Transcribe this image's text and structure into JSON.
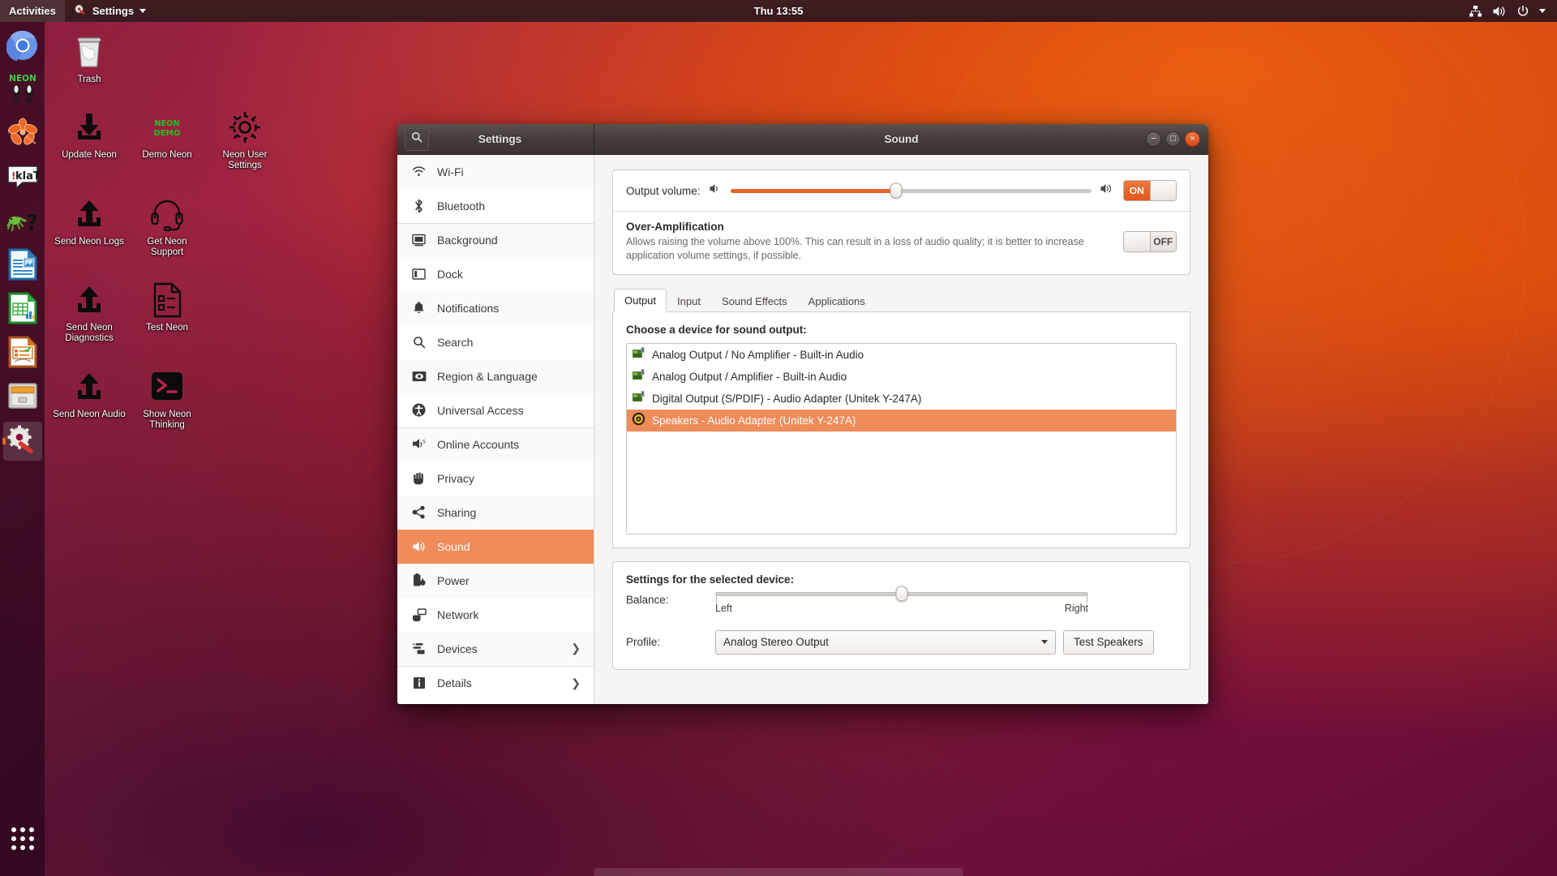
{
  "top_panel": {
    "activities": "Activities",
    "app_menu": "Settings",
    "app_menu_icon": "settings-gear-wrench-icon",
    "clock": "Thu 13:55",
    "tray_icons": [
      "network-wired-icon",
      "volume-icon",
      "power-icon",
      "caret-down-icon"
    ]
  },
  "dock": {
    "items": [
      {
        "name": "chromium",
        "icon": "chromium-icon",
        "active": false
      },
      {
        "name": "neon-mics",
        "icon": "neon-microphones-icon",
        "active": false
      },
      {
        "name": "mycroft-flower",
        "icon": "mycroft-flower-icon",
        "active": false
      },
      {
        "name": "klat",
        "icon": "klat-speech-bubble-icon",
        "active": false
      },
      {
        "name": "gecko-help",
        "icon": "gecko-question-icon",
        "active": false
      },
      {
        "name": "libreoffice-writer",
        "icon": "libreoffice-writer-icon",
        "active": false
      },
      {
        "name": "libreoffice-calc",
        "icon": "libreoffice-calc-icon",
        "active": false
      },
      {
        "name": "libreoffice-impress",
        "icon": "libreoffice-impress-icon",
        "active": false
      },
      {
        "name": "file-manager",
        "icon": "file-cabinet-icon",
        "active": false
      },
      {
        "name": "settings",
        "icon": "settings-gear-wrench-icon",
        "active": true
      }
    ],
    "show_apps": "show-applications-icon"
  },
  "desktop_icons": [
    {
      "label": "Trash",
      "icon": "trash-icon"
    },
    {
      "label": "Update Neon",
      "icon": "download-arrow-icon"
    },
    {
      "label": "Demo Neon",
      "icon": "neon-demo-text-icon",
      "badge": "NEON\nDEMO"
    },
    {
      "label": "Neon User Settings",
      "icon": "gear-icon"
    },
    {
      "label": "Send Neon Logs",
      "icon": "upload-arrow-icon"
    },
    {
      "label": "Get Neon Support",
      "icon": "headset-icon"
    },
    {
      "label": "Send Neon Diagnostics",
      "icon": "upload-arrow-icon"
    },
    {
      "label": "Test Neon",
      "icon": "document-checklist-icon"
    },
    {
      "label": "Send Neon Audio",
      "icon": "upload-arrow-icon"
    },
    {
      "label": "Show Neon Thinking",
      "icon": "terminal-icon"
    }
  ],
  "window": {
    "sidebar_title": "Settings",
    "title": "Sound",
    "search_icon": "search-icon",
    "controls": {
      "minimize": "−",
      "maximize": "□",
      "close": "×"
    }
  },
  "sidebar": {
    "items": [
      {
        "label": "Wi-Fi",
        "icon": "wifi-icon",
        "selected": false,
        "chevron": false,
        "group_start": false
      },
      {
        "label": "Bluetooth",
        "icon": "bluetooth-icon",
        "selected": false,
        "chevron": false,
        "group_start": false
      },
      {
        "label": "Background",
        "icon": "background-icon",
        "selected": false,
        "chevron": false,
        "group_start": true
      },
      {
        "label": "Dock",
        "icon": "dock-icon",
        "selected": false,
        "chevron": false,
        "group_start": false
      },
      {
        "label": "Notifications",
        "icon": "bell-icon",
        "selected": false,
        "chevron": false,
        "group_start": false
      },
      {
        "label": "Search",
        "icon": "search-icon",
        "selected": false,
        "chevron": false,
        "group_start": false
      },
      {
        "label": "Region & Language",
        "icon": "region-language-icon",
        "selected": false,
        "chevron": false,
        "group_start": false
      },
      {
        "label": "Universal Access",
        "icon": "universal-access-icon",
        "selected": false,
        "chevron": false,
        "group_start": false
      },
      {
        "label": "Online Accounts",
        "icon": "online-accounts-icon",
        "selected": false,
        "chevron": false,
        "group_start": true
      },
      {
        "label": "Privacy",
        "icon": "privacy-hand-icon",
        "selected": false,
        "chevron": false,
        "group_start": false
      },
      {
        "label": "Sharing",
        "icon": "sharing-icon",
        "selected": false,
        "chevron": false,
        "group_start": false
      },
      {
        "label": "Sound",
        "icon": "sound-icon",
        "selected": true,
        "chevron": false,
        "group_start": false
      },
      {
        "label": "Power",
        "icon": "power-battery-icon",
        "selected": false,
        "chevron": false,
        "group_start": false
      },
      {
        "label": "Network",
        "icon": "network-icon",
        "selected": false,
        "chevron": false,
        "group_start": false
      },
      {
        "label": "Devices",
        "icon": "devices-icon",
        "selected": false,
        "chevron": true,
        "group_start": false
      },
      {
        "label": "Details",
        "icon": "details-info-icon",
        "selected": false,
        "chevron": true,
        "group_start": true
      }
    ]
  },
  "sound": {
    "output_volume_label": "Output volume:",
    "output_volume_percent": 46,
    "volume_low_icon": "volume-low-icon",
    "volume_high_icon": "volume-high-icon",
    "output_toggle": {
      "state": "ON",
      "label": "ON"
    },
    "over_amplification": {
      "title": "Over-Amplification",
      "description": "Allows raising the volume above 100%. This can result in a loss of audio quality; it is better to increase application volume settings, if possible.",
      "toggle": {
        "state": "OFF",
        "label": "OFF"
      }
    },
    "tabs": [
      {
        "label": "Output",
        "active": true
      },
      {
        "label": "Input",
        "active": false
      },
      {
        "label": "Sound Effects",
        "active": false
      },
      {
        "label": "Applications",
        "active": false
      }
    ],
    "choose_device_label": "Choose a device for sound output:",
    "devices": [
      {
        "label": "Analog Output / No Amplifier - Built-in Audio",
        "icon": "audio-card-icon",
        "selected": false
      },
      {
        "label": "Analog Output / Amplifier - Built-in Audio",
        "icon": "audio-card-icon",
        "selected": false
      },
      {
        "label": "Digital Output (S/PDIF) - Audio Adapter (Unitek Y-247A)",
        "icon": "audio-card-icon",
        "selected": false
      },
      {
        "label": "Speakers - Audio Adapter (Unitek Y-247A)",
        "icon": "speaker-icon",
        "selected": true
      }
    ],
    "device_settings": {
      "title": "Settings for the selected device:",
      "balance_label": "Balance:",
      "balance_value": 50,
      "balance_left": "Left",
      "balance_right": "Right",
      "profile_label": "Profile:",
      "profile_value": "Analog Stereo Output",
      "test_speakers_label": "Test Speakers"
    }
  },
  "colors": {
    "accent_orange": "#e8622a",
    "selection_orange": "#f08b5a",
    "panel_dark": "#3a1a1e",
    "window_chrome": "#413a37"
  }
}
